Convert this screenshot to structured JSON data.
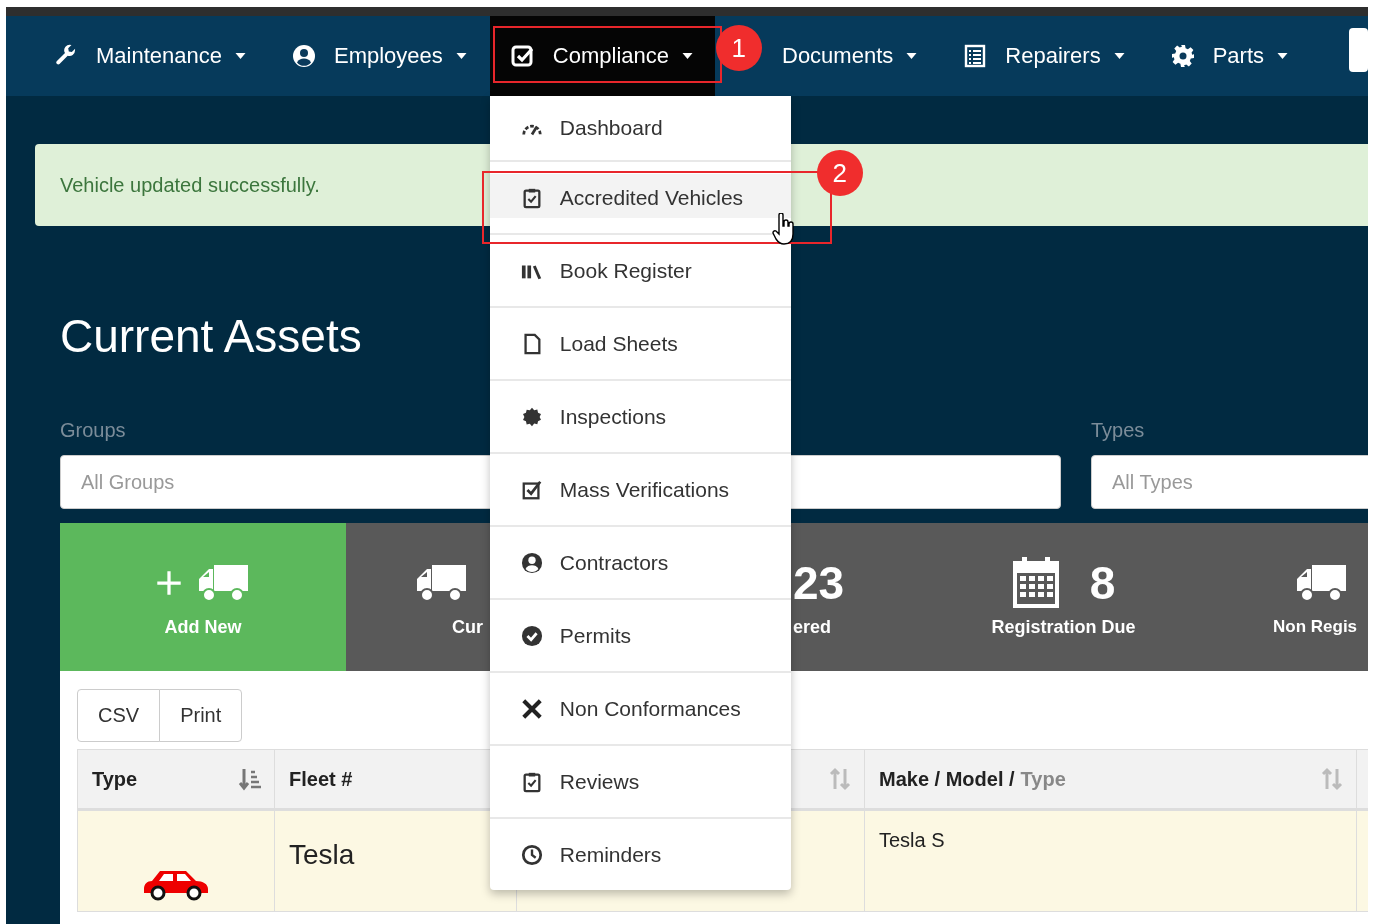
{
  "navbar": {
    "items": [
      {
        "label": "Maintenance",
        "selected": false
      },
      {
        "label": "Employees",
        "selected": false
      },
      {
        "label": "Compliance",
        "selected": true
      },
      {
        "label": "Documents",
        "selected": false
      },
      {
        "label": "Repairers",
        "selected": false
      },
      {
        "label": "Parts",
        "selected": false
      }
    ]
  },
  "compliance_menu": {
    "items": [
      {
        "label": "Dashboard",
        "selected": false
      },
      {
        "label": "Accredited Vehicles",
        "selected": true
      },
      {
        "label": "Book Register",
        "selected": false
      },
      {
        "label": "Load Sheets",
        "selected": false
      },
      {
        "label": "Inspections",
        "selected": false
      },
      {
        "label": "Mass Verifications",
        "selected": false
      },
      {
        "label": "Contractors",
        "selected": false
      },
      {
        "label": "Permits",
        "selected": false
      },
      {
        "label": "Non Conformances",
        "selected": false
      },
      {
        "label": "Reviews",
        "selected": false
      },
      {
        "label": "Reminders",
        "selected": false
      }
    ]
  },
  "annotations": [
    {
      "label": "1"
    },
    {
      "label": "2"
    }
  ],
  "alert": {
    "message": "Vehicle updated successfully."
  },
  "title": "Current Assets",
  "filters": [
    {
      "label": "Groups",
      "placeholder": "All Groups"
    },
    {
      "label": "Types",
      "placeholder": "All Types"
    }
  ],
  "stats": [
    {
      "kind": "add",
      "label": "Add New"
    },
    {
      "kind": "stat",
      "label": "Cur"
    },
    {
      "kind": "stat",
      "value": "23",
      "label": "ered"
    },
    {
      "kind": "stat",
      "value": "8",
      "label": "Registration Due"
    },
    {
      "kind": "stat",
      "label": "Non Regis"
    }
  ],
  "export_buttons": [
    "CSV",
    "Print"
  ],
  "table": {
    "columns": [
      {
        "title": "Type",
        "sorted": true
      },
      {
        "title": "Fleet #"
      },
      {
        "sorted": false
      },
      {
        "title": "Make / Model /",
        "subtitle": "Type",
        "sorted": false
      }
    ],
    "rows": [
      {
        "fleet": "Tesla",
        "make_model": "Tesla S"
      }
    ]
  }
}
